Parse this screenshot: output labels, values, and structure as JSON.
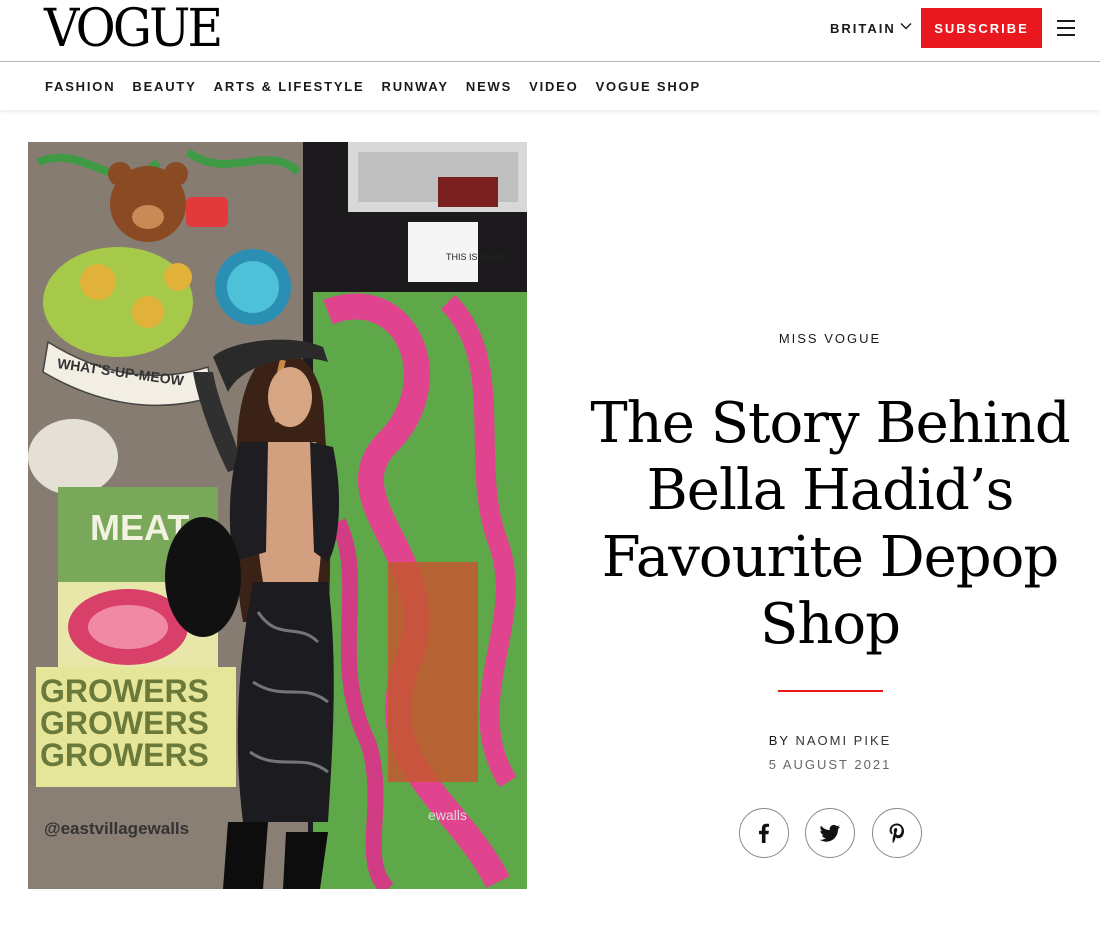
{
  "header": {
    "logo": "VOGUE",
    "edition": "BRITAIN",
    "subscribe_label": "SUBSCRIBE",
    "menu_icon": "hamburger-menu-icon",
    "accent_color": "#e8181e"
  },
  "nav": {
    "items": [
      "FASHION",
      "BEAUTY",
      "ARTS & LIFESTYLE",
      "RUNWAY",
      "NEWS",
      "VIDEO",
      "VOGUE SHOP"
    ]
  },
  "hero": {
    "poster_words": [
      "MEAT",
      "GROWERS",
      "GROWERS",
      "GROWERS"
    ],
    "banner_text": "WHAT'S-UP-MEOW",
    "sticker_text": "THIS IS OKAY",
    "watermark": "@eastvillagewalls",
    "watermark_tail": "ewalls"
  },
  "article": {
    "kicker": "MISS VOGUE",
    "headline_lines": [
      "The Story Behind",
      "Bella Hadid’s",
      "Favourite Depop",
      "Shop"
    ],
    "byline_prefix": "BY",
    "author": "NAOMI PIKE",
    "date": "5 AUGUST 2021"
  },
  "share": {
    "icons": [
      "facebook-icon",
      "twitter-icon",
      "pinterest-icon"
    ]
  }
}
